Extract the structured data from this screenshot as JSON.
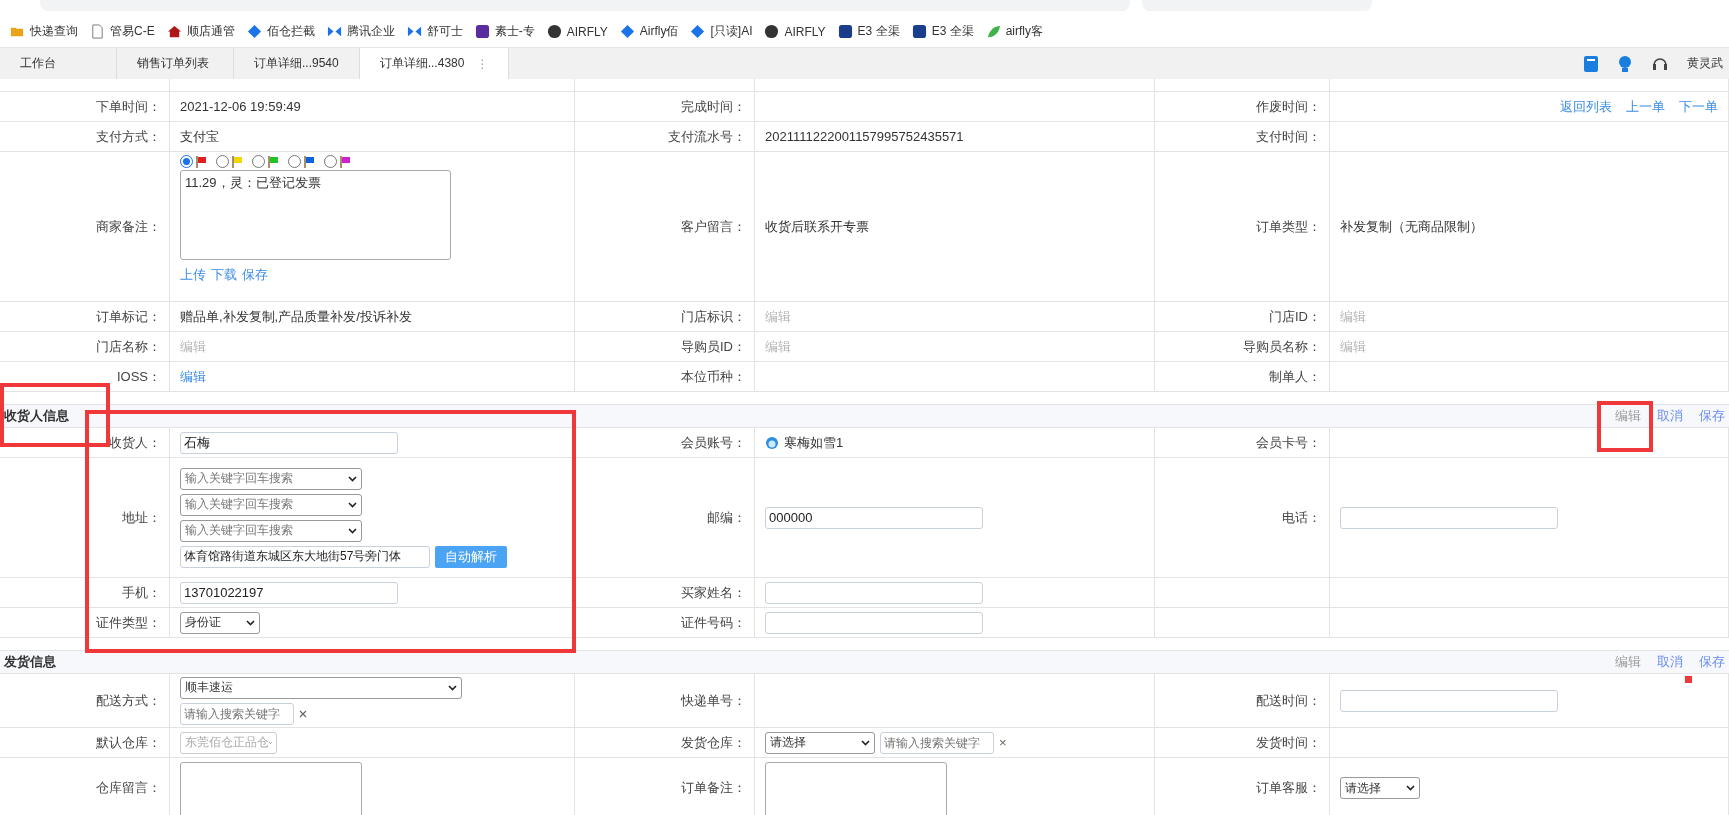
{
  "bookmarks": [
    {
      "label": "快递查询"
    },
    {
      "label": "管易C-E"
    },
    {
      "label": "顺店通管"
    },
    {
      "label": "佰仓拦截"
    },
    {
      "label": "腾讯企业"
    },
    {
      "label": "舒可士"
    },
    {
      "label": "素士-专"
    },
    {
      "label": "AIRFLY"
    },
    {
      "label": "Airfly佰"
    },
    {
      "label": "[只读]AI"
    },
    {
      "label": "AIRFLY"
    },
    {
      "label": "E3 全渠"
    },
    {
      "label": "E3 全渠"
    },
    {
      "label": "airfly客"
    }
  ],
  "tabs": [
    {
      "label": "工作台",
      "selected": false
    },
    {
      "label": "销售订单列表",
      "selected": false
    },
    {
      "label": "订单详细...9540",
      "selected": false
    },
    {
      "label": "订单详细...4380",
      "selected": true,
      "menu": "⋮"
    }
  ],
  "user": "黄灵武",
  "order_rows": [
    {
      "cells": [
        {
          "label": "下单时间：",
          "value": {
            "kind": "text",
            "text": "2021-12-06 19:59:49"
          }
        },
        {
          "label": "完成时间：",
          "value": {
            "kind": "empty"
          }
        },
        {
          "label": "作废时间：",
          "value": {
            "kind": "links",
            "links": [
              "返回列表",
              "上一单",
              "下一单"
            ]
          }
        }
      ]
    },
    {
      "cells": [
        {
          "label": "支付方式：",
          "value": {
            "kind": "text",
            "text": "支付宝"
          }
        },
        {
          "label": "支付流水号：",
          "value": {
            "kind": "text",
            "text": "2021111222001157995752435571"
          }
        },
        {
          "label": "支付时间：",
          "value": {
            "kind": "empty"
          }
        }
      ]
    },
    {
      "cells": [
        {
          "label": "商家备注：",
          "value": {
            "kind": "remark",
            "flags": [
              {
                "color": "#e02020",
                "selected": true
              },
              {
                "color": "#f2d600",
                "selected": false
              },
              {
                "color": "#22c322",
                "selected": false
              },
              {
                "color": "#1060e0",
                "selected": false
              },
              {
                "color": "#d020d0",
                "selected": false
              }
            ],
            "note": "11.29，灵：已登记发票",
            "actions": [
              "上传",
              "下载",
              "保存"
            ]
          }
        },
        {
          "label": "客户留言：",
          "value": {
            "kind": "text",
            "text": "收货后联系开专票"
          }
        },
        {
          "label": "订单类型：",
          "value": {
            "kind": "text",
            "text": "补发复制（无商品限制）"
          }
        }
      ]
    },
    {
      "cells": [
        {
          "label": "订单标记：",
          "value": {
            "kind": "text",
            "text": "赠品单,补发复制,产品质量补发/投诉补发"
          }
        },
        {
          "label": "门店标识：",
          "value": {
            "kind": "muted",
            "text": "编辑"
          }
        },
        {
          "label": "门店ID：",
          "value": {
            "kind": "muted",
            "text": "编辑"
          }
        }
      ]
    },
    {
      "cells": [
        {
          "label": "门店名称：",
          "value": {
            "kind": "muted",
            "text": "编辑"
          }
        },
        {
          "label": "导购员ID：",
          "value": {
            "kind": "muted",
            "text": "编辑"
          }
        },
        {
          "label": "导购员名称：",
          "value": {
            "kind": "muted",
            "text": "编辑"
          }
        }
      ]
    },
    {
      "cells": [
        {
          "label": "IOSS：",
          "value": {
            "kind": "link",
            "text": "编辑"
          }
        },
        {
          "label": "本位币种：",
          "value": {
            "kind": "empty"
          }
        },
        {
          "label": "制单人：",
          "value": {
            "kind": "empty"
          }
        }
      ]
    }
  ],
  "sections": [
    {
      "title": "收货人信息",
      "actions": [
        {
          "label": "编辑",
          "disabled": true
        },
        {
          "label": "取消",
          "disabled": false
        },
        {
          "label": "保存",
          "disabled": false
        }
      ],
      "rows": [
        {
          "cells": [
            {
              "label": "收货人：",
              "value": {
                "kind": "input",
                "value": "石梅"
              }
            },
            {
              "label": "会员账号：",
              "value": {
                "kind": "member",
                "text": "寒梅如雪1"
              }
            },
            {
              "label": "会员卡号：",
              "value": {
                "kind": "empty"
              }
            }
          ]
        },
        {
          "cells": [
            {
              "label": "地址：",
              "value": {
                "kind": "address",
                "selects": [
                  "输入关键字回车搜索",
                  "输入关键字回车搜索",
                  "输入关键字回车搜索"
                ],
                "detail": "体育馆路街道东城区东大地街57号旁门体",
                "button": "自动解析"
              }
            },
            {
              "label": "邮编：",
              "value": {
                "kind": "input",
                "value": "000000"
              }
            },
            {
              "label": "电话：",
              "value": {
                "kind": "input"
              }
            }
          ]
        },
        {
          "cells": [
            {
              "label": "手机：",
              "value": {
                "kind": "input",
                "value": "13701022197"
              }
            },
            {
              "label": "买家姓名：",
              "value": {
                "kind": "input"
              }
            },
            {
              "value": {
                "kind": "empty"
              }
            }
          ]
        },
        {
          "cells": [
            {
              "label": "证件类型：",
              "value": {
                "kind": "select",
                "value": "身份证"
              }
            },
            {
              "label": "证件号码：",
              "value": {
                "kind": "input"
              }
            },
            {
              "value": {
                "kind": "empty"
              }
            }
          ]
        }
      ]
    },
    {
      "title": "发货信息",
      "actions": [
        {
          "label": "编辑",
          "disabled": true
        },
        {
          "label": "取消",
          "disabled": false
        },
        {
          "label": "保存",
          "disabled": false
        }
      ],
      "rows": [
        {
          "cells": [
            {
              "label": "配送方式：",
              "value": {
                "kind": "select-search-stacked",
                "value": "顺丰速运",
                "placeholder": "请输入搜索关键字"
              }
            },
            {
              "label": "快递单号：",
              "value": {
                "kind": "empty"
              }
            },
            {
              "label": "配送时间：",
              "value": {
                "kind": "input"
              }
            }
          ]
        },
        {
          "cells": [
            {
              "label": "默认仓库：",
              "value": {
                "kind": "select",
                "value": "东莞佰仓正品仓",
                "disabled": true
              }
            },
            {
              "label": "发货仓库：",
              "value": {
                "kind": "select-search",
                "value": "请选择",
                "placeholder": "请输入搜索关键字",
                "clear": "×"
              }
            },
            {
              "label": "发货时间：",
              "value": {
                "kind": "empty"
              }
            }
          ]
        },
        {
          "cells": [
            {
              "label": "仓库留言：",
              "value": {
                "kind": "textarea"
              }
            },
            {
              "label": "订单备注：",
              "value": {
                "kind": "textarea"
              }
            },
            {
              "label": "订单客服：",
              "value": {
                "kind": "select",
                "value": "请选择"
              }
            }
          ]
        }
      ]
    }
  ],
  "annotations": [
    {
      "kind": "frame"
    },
    {
      "kind": "frame"
    },
    {
      "kind": "frame"
    },
    {
      "kind": "dot"
    }
  ]
}
